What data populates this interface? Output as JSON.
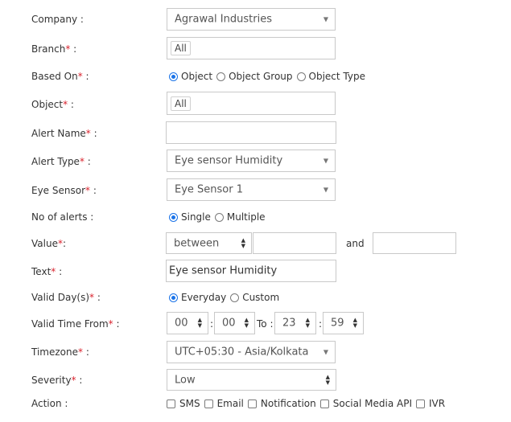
{
  "labels": {
    "company": "Company :",
    "branch": "Branch",
    "based_on": "Based On",
    "object": "Object",
    "alert_name": "Alert Name",
    "alert_type": "Alert Type",
    "eye_sensor": "Eye Sensor",
    "no_of_alerts": "No of alerts :",
    "value": "Value",
    "text": "Text",
    "valid_days": "Valid Day(s)",
    "valid_time_from": "Valid Time From",
    "timezone": "Timezone",
    "severity": "Severity",
    "action": "Action :",
    "required_mark": "*",
    "colon": " :",
    "colon_nospace": ":"
  },
  "fields": {
    "company": "Agrawal Industries",
    "branch_tag": "All",
    "based_on_options": [
      "Object",
      "Object Group",
      "Object Type"
    ],
    "object_tag": "All",
    "alert_name": "",
    "alert_type": "Eye sensor Humidity",
    "eye_sensor": "Eye Sensor 1",
    "no_of_alerts_options": [
      "Single",
      "Multiple"
    ],
    "value_operator": "between",
    "value_min": "",
    "value_and": "and",
    "value_max": "",
    "text": "Eye sensor Humidity",
    "valid_days_options": [
      "Everyday",
      "Custom"
    ],
    "time_from_hour": "00",
    "time_from_min": "00",
    "time_to_label": "To :",
    "time_to_hour": "23",
    "time_to_min": "59",
    "time_colon": ":",
    "timezone": "UTC+05:30 - Asia/Kolkata",
    "severity": "Low",
    "actions": [
      "SMS",
      "Email",
      "Notification",
      "Social Media API",
      "IVR"
    ]
  },
  "icons": {
    "dropdown_caret": "▼",
    "spinner_up": "▲",
    "spinner_down": "▼"
  },
  "colors": {
    "accent": "#1a73e8",
    "required": "#d9232e",
    "border": "#c9c9c9"
  }
}
